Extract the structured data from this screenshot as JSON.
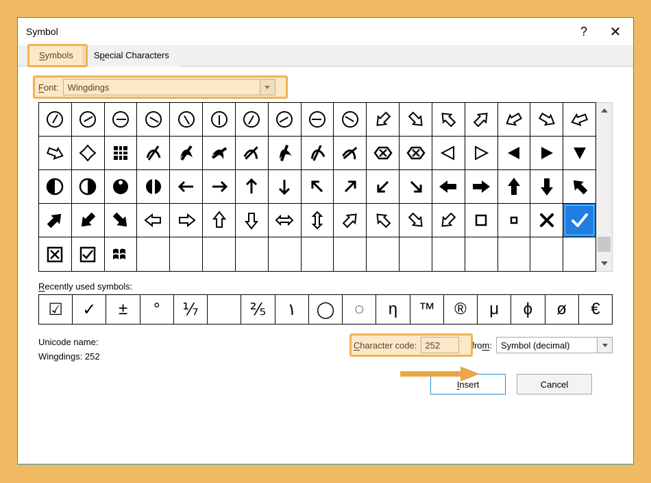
{
  "window": {
    "title": "Symbol",
    "help_glyph": "?",
    "close_glyph": "✕"
  },
  "tabs": {
    "symbols": "Symbols",
    "special": "Special Characters"
  },
  "font": {
    "label": "Font:",
    "value": "Wingdings"
  },
  "grid": {
    "rows": [
      [
        "clock1",
        "clock2",
        "clock3",
        "clock4",
        "clock5",
        "clock6",
        "clock7",
        "clock8",
        "clock9",
        "clock10",
        "arr-dl",
        "arr-dr",
        "arr-ul-out",
        "arr-ur-out",
        "arr-dl-in",
        "arr-dr-in",
        "arr-dl-curve"
      ],
      [
        "arr-dr-curve",
        "leaf-cross",
        "weave",
        "curve-slash",
        "swirl-left",
        "swirl-cl",
        "swirl-slash",
        "swirl-cl2",
        "swirl-dash",
        "swirl-dash2",
        "box-x-l",
        "box-x-r",
        "tri-open-l",
        "tri-open-r",
        "tri-fill-l",
        "tri-fill-r",
        "tri-fill-dn"
      ],
      [
        "circ-half-l",
        "circ-half-r",
        "circ-dot-top",
        "circ-split",
        "arr-left-thin",
        "arr-right-thin",
        "arr-up-thin",
        "arr-down-thin",
        "arr-nw-thin",
        "arr-ne-thin",
        "arr-sw-thin",
        "arr-se-thin",
        "arr-left-bold",
        "arr-right-bold",
        "arr-up-bold",
        "arr-down-bold",
        "arr-nw-bold"
      ],
      [
        "arr-ne-bold",
        "arr-sw-bold",
        "arr-se-bold",
        "arr-left-out",
        "arr-right-out",
        "arr-up-out",
        "arr-down-out",
        "arr-lr-out",
        "arr-ud-out",
        "arr-ne-out",
        "arr-nw-out",
        "arr-se-out",
        "arr-sw-out",
        "sq-out",
        "sq-small",
        "x-mark",
        "check"
      ],
      [
        "box-x",
        "box-check",
        "win-logo",
        "",
        "",
        "",
        "",
        "",
        "",
        "",
        "",
        "",
        "",
        "",
        "",
        "",
        ""
      ]
    ],
    "selected": {
      "row": 3,
      "col": 16
    }
  },
  "recent": {
    "label": "Recently used symbols:",
    "items": [
      "☑",
      "✓",
      "±",
      "°",
      "⅐",
      "",
      "⅖",
      "١",
      "◯",
      "◌",
      "η",
      "™",
      "®",
      "μ",
      "ϕ",
      "ø",
      "€"
    ]
  },
  "info": {
    "unicode_label": "Unicode name:",
    "unicode_value": "Wingdings: 252",
    "charcode_label": "Character code:",
    "charcode_value": "252",
    "from_label": "from:",
    "from_value": "Symbol (decimal)"
  },
  "buttons": {
    "insert": "Insert",
    "cancel": "Cancel"
  }
}
